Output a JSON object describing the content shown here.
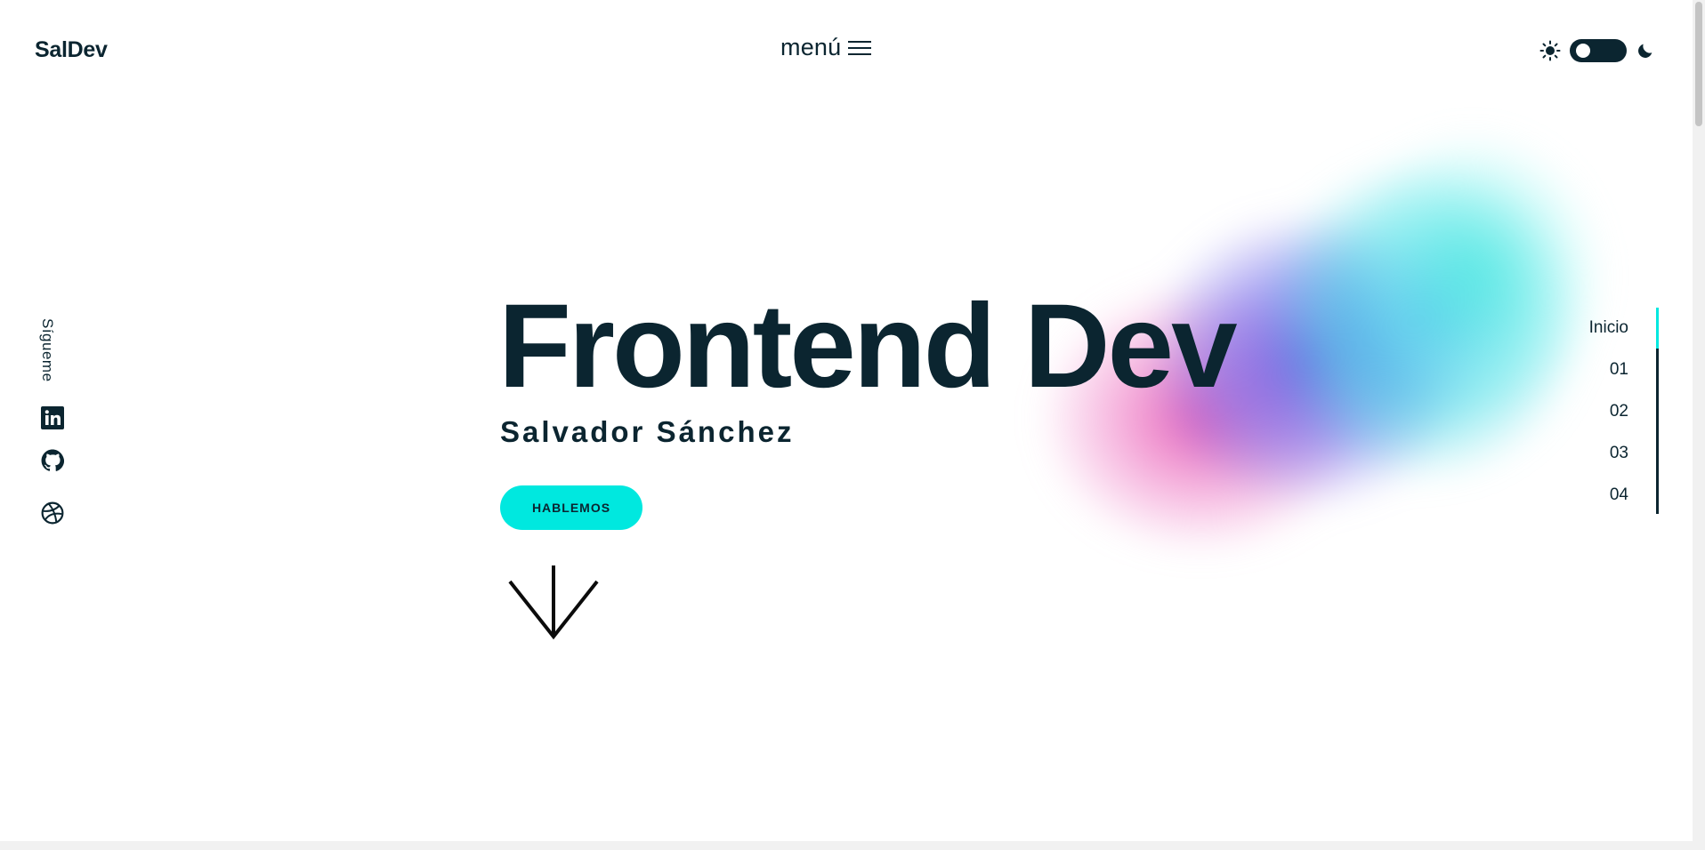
{
  "header": {
    "logo": "SalDev",
    "menu_label": "menú",
    "theme": {
      "light_icon": "sun-icon",
      "dark_icon": "moon-icon",
      "mode": "light"
    }
  },
  "social": {
    "label": "Sígueme",
    "links": [
      {
        "name": "linkedin",
        "icon": "linkedin-icon"
      },
      {
        "name": "github",
        "icon": "github-icon"
      },
      {
        "name": "dribbble",
        "icon": "dribbble-icon"
      }
    ]
  },
  "hero": {
    "title": "Frontend Dev",
    "subtitle": "Salvador Sánchez",
    "cta_label": "HABLEMOS",
    "scroll_icon": "arrow-down-icon"
  },
  "section_nav": {
    "items": [
      {
        "label": "Inicio",
        "active": true
      },
      {
        "label": "01",
        "active": false
      },
      {
        "label": "02",
        "active": false
      },
      {
        "label": "03",
        "active": false
      },
      {
        "label": "04",
        "active": false
      }
    ]
  },
  "colors": {
    "text": "#0b2530",
    "accent": "#00e8df",
    "background": "#ffffff"
  }
}
